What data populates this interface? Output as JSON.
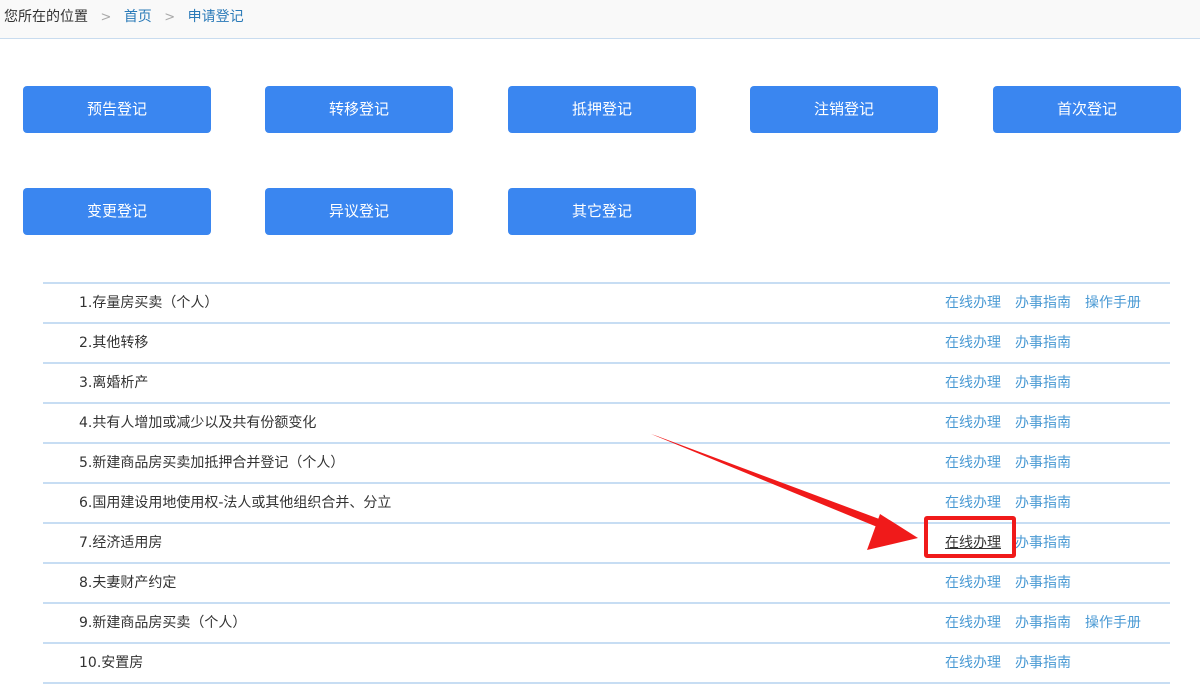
{
  "breadcrumb": {
    "prefix": "您所在的位置",
    "separator": ">",
    "home": "首页",
    "current": "申请登记"
  },
  "buttons": [
    {
      "label": "预告登记"
    },
    {
      "label": "转移登记"
    },
    {
      "label": "抵押登记"
    },
    {
      "label": "注销登记"
    },
    {
      "label": "首次登记"
    },
    {
      "label": "变更登记"
    },
    {
      "label": "异议登记"
    },
    {
      "label": "其它登记"
    }
  ],
  "actions": {
    "online": "在线办理",
    "guide": "办事指南",
    "manual": "操作手册"
  },
  "items": [
    {
      "title": "1.存量房买卖（个人）"
    },
    {
      "title": "2.其他转移"
    },
    {
      "title": "3.离婚析产"
    },
    {
      "title": "4.共有人增加或减少以及共有份额变化"
    },
    {
      "title": "5.新建商品房买卖加抵押合并登记（个人）"
    },
    {
      "title": "6.国用建设用地使用权-法人或其他组织合并、分立"
    },
    {
      "title": "7.经济适用房"
    },
    {
      "title": "8.夫妻财产约定"
    },
    {
      "title": "9.新建商品房买卖（个人）"
    },
    {
      "title": "10.安置房"
    }
  ],
  "colors": {
    "button": "#3a86f0",
    "link": "#4a9ad4",
    "highlight": "#f01a1a"
  }
}
